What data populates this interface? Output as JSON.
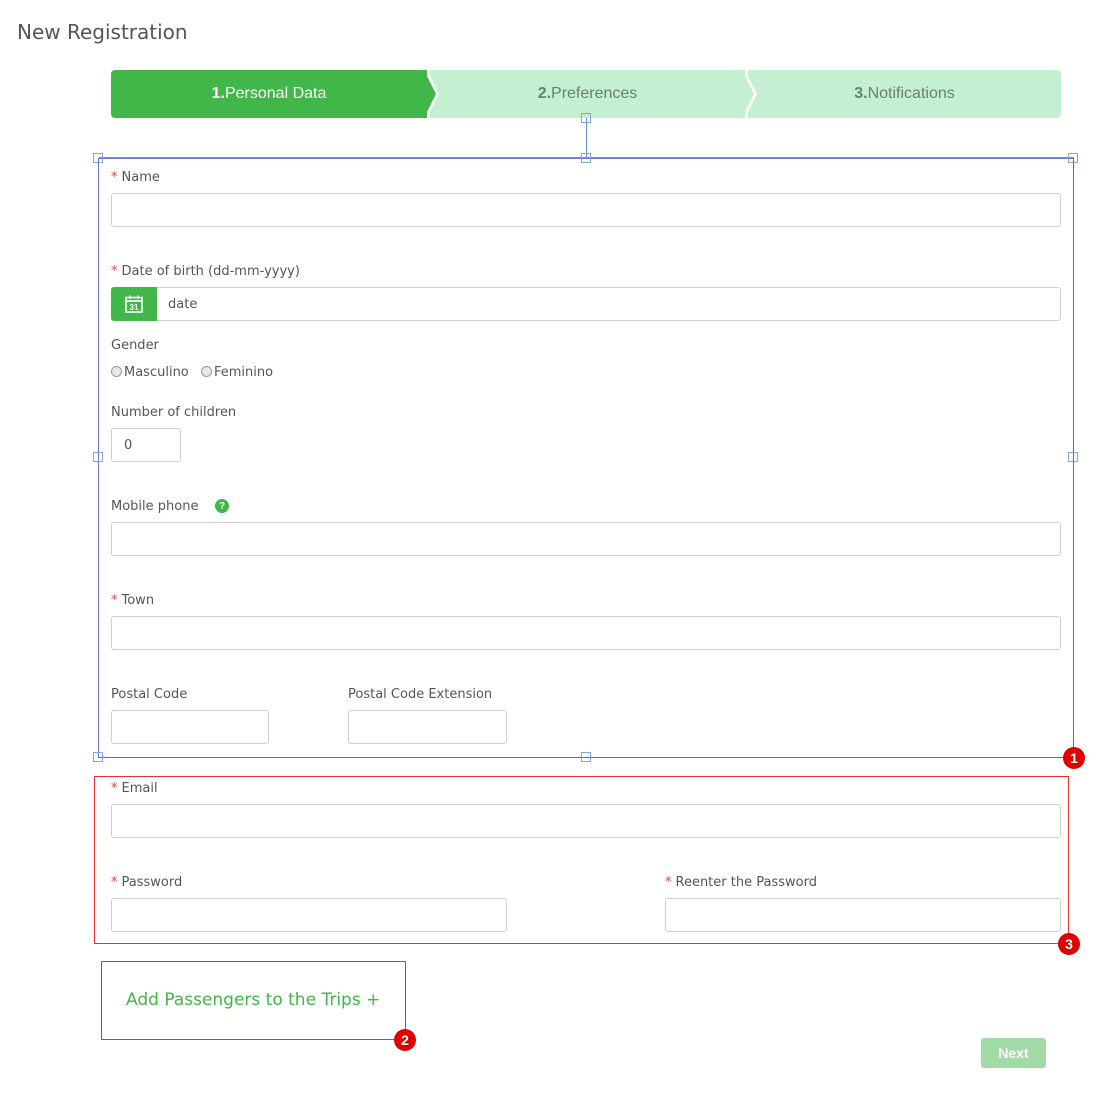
{
  "page": {
    "title": "New Registration"
  },
  "stepper": {
    "steps": [
      {
        "number": "1.",
        "label": "Personal Data",
        "state": "active"
      },
      {
        "number": "2.",
        "label": "Preferences",
        "state": "inactive"
      },
      {
        "number": "3.",
        "label": "Notifications",
        "state": "inactive"
      }
    ]
  },
  "form": {
    "name": {
      "label": "Name",
      "required": true,
      "value": ""
    },
    "dob": {
      "label": "Date of birth (dd-mm-yyyy)",
      "required": true,
      "placeholder": "date",
      "icon": "calendar-icon",
      "icon_text": "31"
    },
    "gender": {
      "label": "Gender",
      "options": [
        "Masculino",
        "Feminino"
      ]
    },
    "children": {
      "label": "Number of children",
      "value": "0"
    },
    "mobile": {
      "label": "Mobile phone",
      "help_icon": "question-icon",
      "help_text": "?",
      "value": ""
    },
    "town": {
      "label": "Town",
      "required": true,
      "value": ""
    },
    "postal_code": {
      "label": "Postal Code",
      "value": ""
    },
    "postal_ext": {
      "label": "Postal Code Extension",
      "value": ""
    },
    "email": {
      "label": "Email",
      "required": true,
      "value": ""
    },
    "password": {
      "label": "Password",
      "required": true,
      "value": ""
    },
    "password_confirm": {
      "label": "Reenter the Password",
      "required": true,
      "value": ""
    },
    "required_marker": "*"
  },
  "add_passengers": {
    "label": "Add Passengers to the Trips +"
  },
  "actions": {
    "next_label": "Next"
  },
  "annotations": {
    "badges": [
      "1",
      "2",
      "3"
    ]
  },
  "colors": {
    "accent": "#41b649",
    "step_inactive_bg": "#c4efd0",
    "required": "#e8463c",
    "annotation_red": "#e00000",
    "selection_blue": "#6a78c8"
  }
}
